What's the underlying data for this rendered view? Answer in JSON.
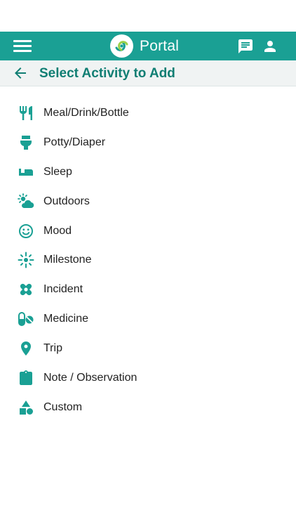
{
  "app": {
    "title": "Portal",
    "colors": {
      "primary": "#1aa094",
      "title": "#107e73",
      "text": "#222222",
      "subheader_bg": "#f0f3f3"
    }
  },
  "header": {
    "menu_icon": "hamburger-menu-icon",
    "logo_icon": "portal-logo-icon",
    "message_icon": "message-icon",
    "account_icon": "account-icon"
  },
  "subheader": {
    "back_icon": "arrow-back-icon",
    "title": "Select Activity to Add"
  },
  "activities": [
    {
      "label": "Meal/Drink/Bottle",
      "icon": "utensils-icon"
    },
    {
      "label": "Potty/Diaper",
      "icon": "toilet-icon"
    },
    {
      "label": "Sleep",
      "icon": "bed-icon"
    },
    {
      "label": "Outdoors",
      "icon": "weather-icon"
    },
    {
      "label": "Mood",
      "icon": "smiley-icon"
    },
    {
      "label": "Milestone",
      "icon": "sparkle-icon"
    },
    {
      "label": "Incident",
      "icon": "bandage-icon"
    },
    {
      "label": "Medicine",
      "icon": "pill-icon"
    },
    {
      "label": "Trip",
      "icon": "location-pin-icon"
    },
    {
      "label": "Note / Observation",
      "icon": "clipboard-icon"
    },
    {
      "label": "Custom",
      "icon": "shapes-icon"
    }
  ]
}
